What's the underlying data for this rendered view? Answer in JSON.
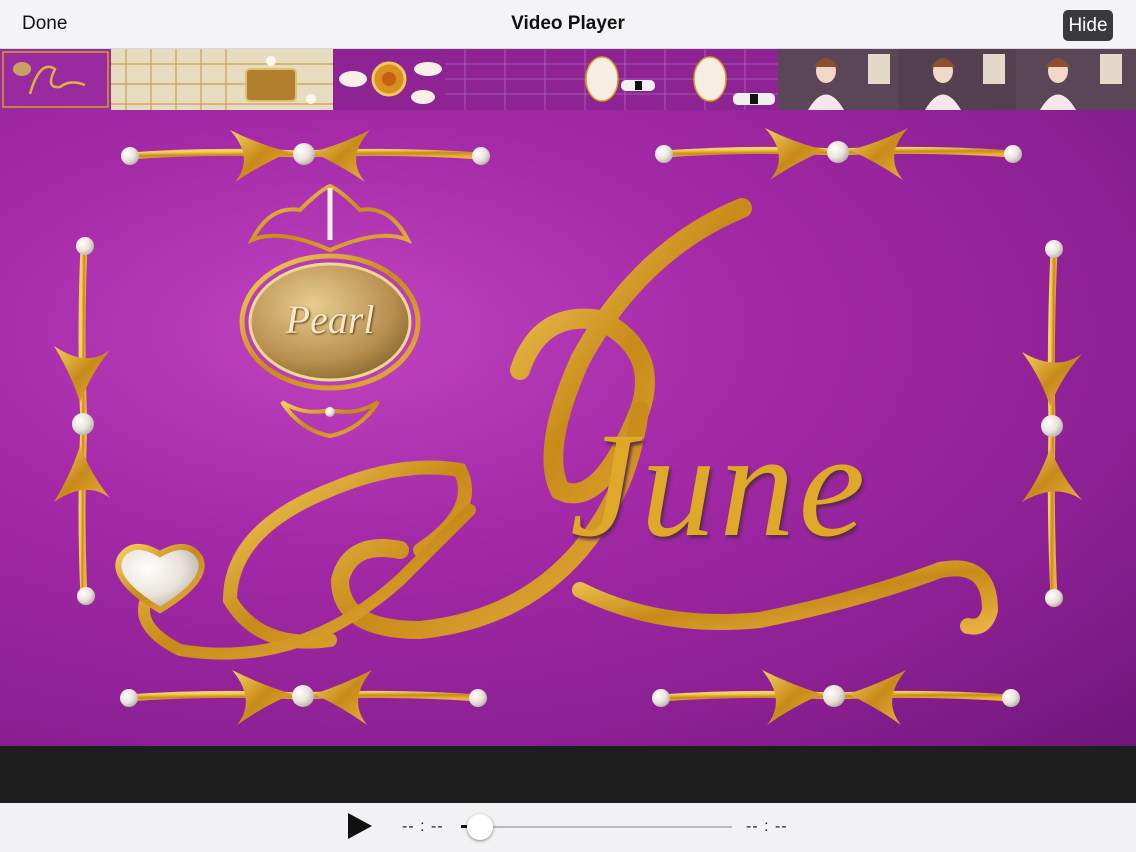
{
  "nav": {
    "done_label": "Done",
    "title": "Video Player",
    "hide_label": "Hide"
  },
  "video": {
    "plaque_text": "Pearl",
    "script_title": "June"
  },
  "controls": {
    "elapsed": "-- : --",
    "remaining": "-- : --",
    "progress_fraction": 0.07
  },
  "filmstrip": {
    "thumbnails": [
      {
        "name": "june-title-thumbnail"
      },
      {
        "name": "pearl-pattern-thumbnail"
      },
      {
        "name": "jewel-clasp-thumbnail"
      },
      {
        "name": "purple-pattern-thumbnail"
      },
      {
        "name": "invitation-thumbnail"
      },
      {
        "name": "portrait-thumbnail"
      }
    ]
  },
  "colors": {
    "accent_purple": "#a42aa8",
    "gold": "#d8a020",
    "pearl": "#f4f0e8",
    "hide_button": "#3a3a3c"
  }
}
